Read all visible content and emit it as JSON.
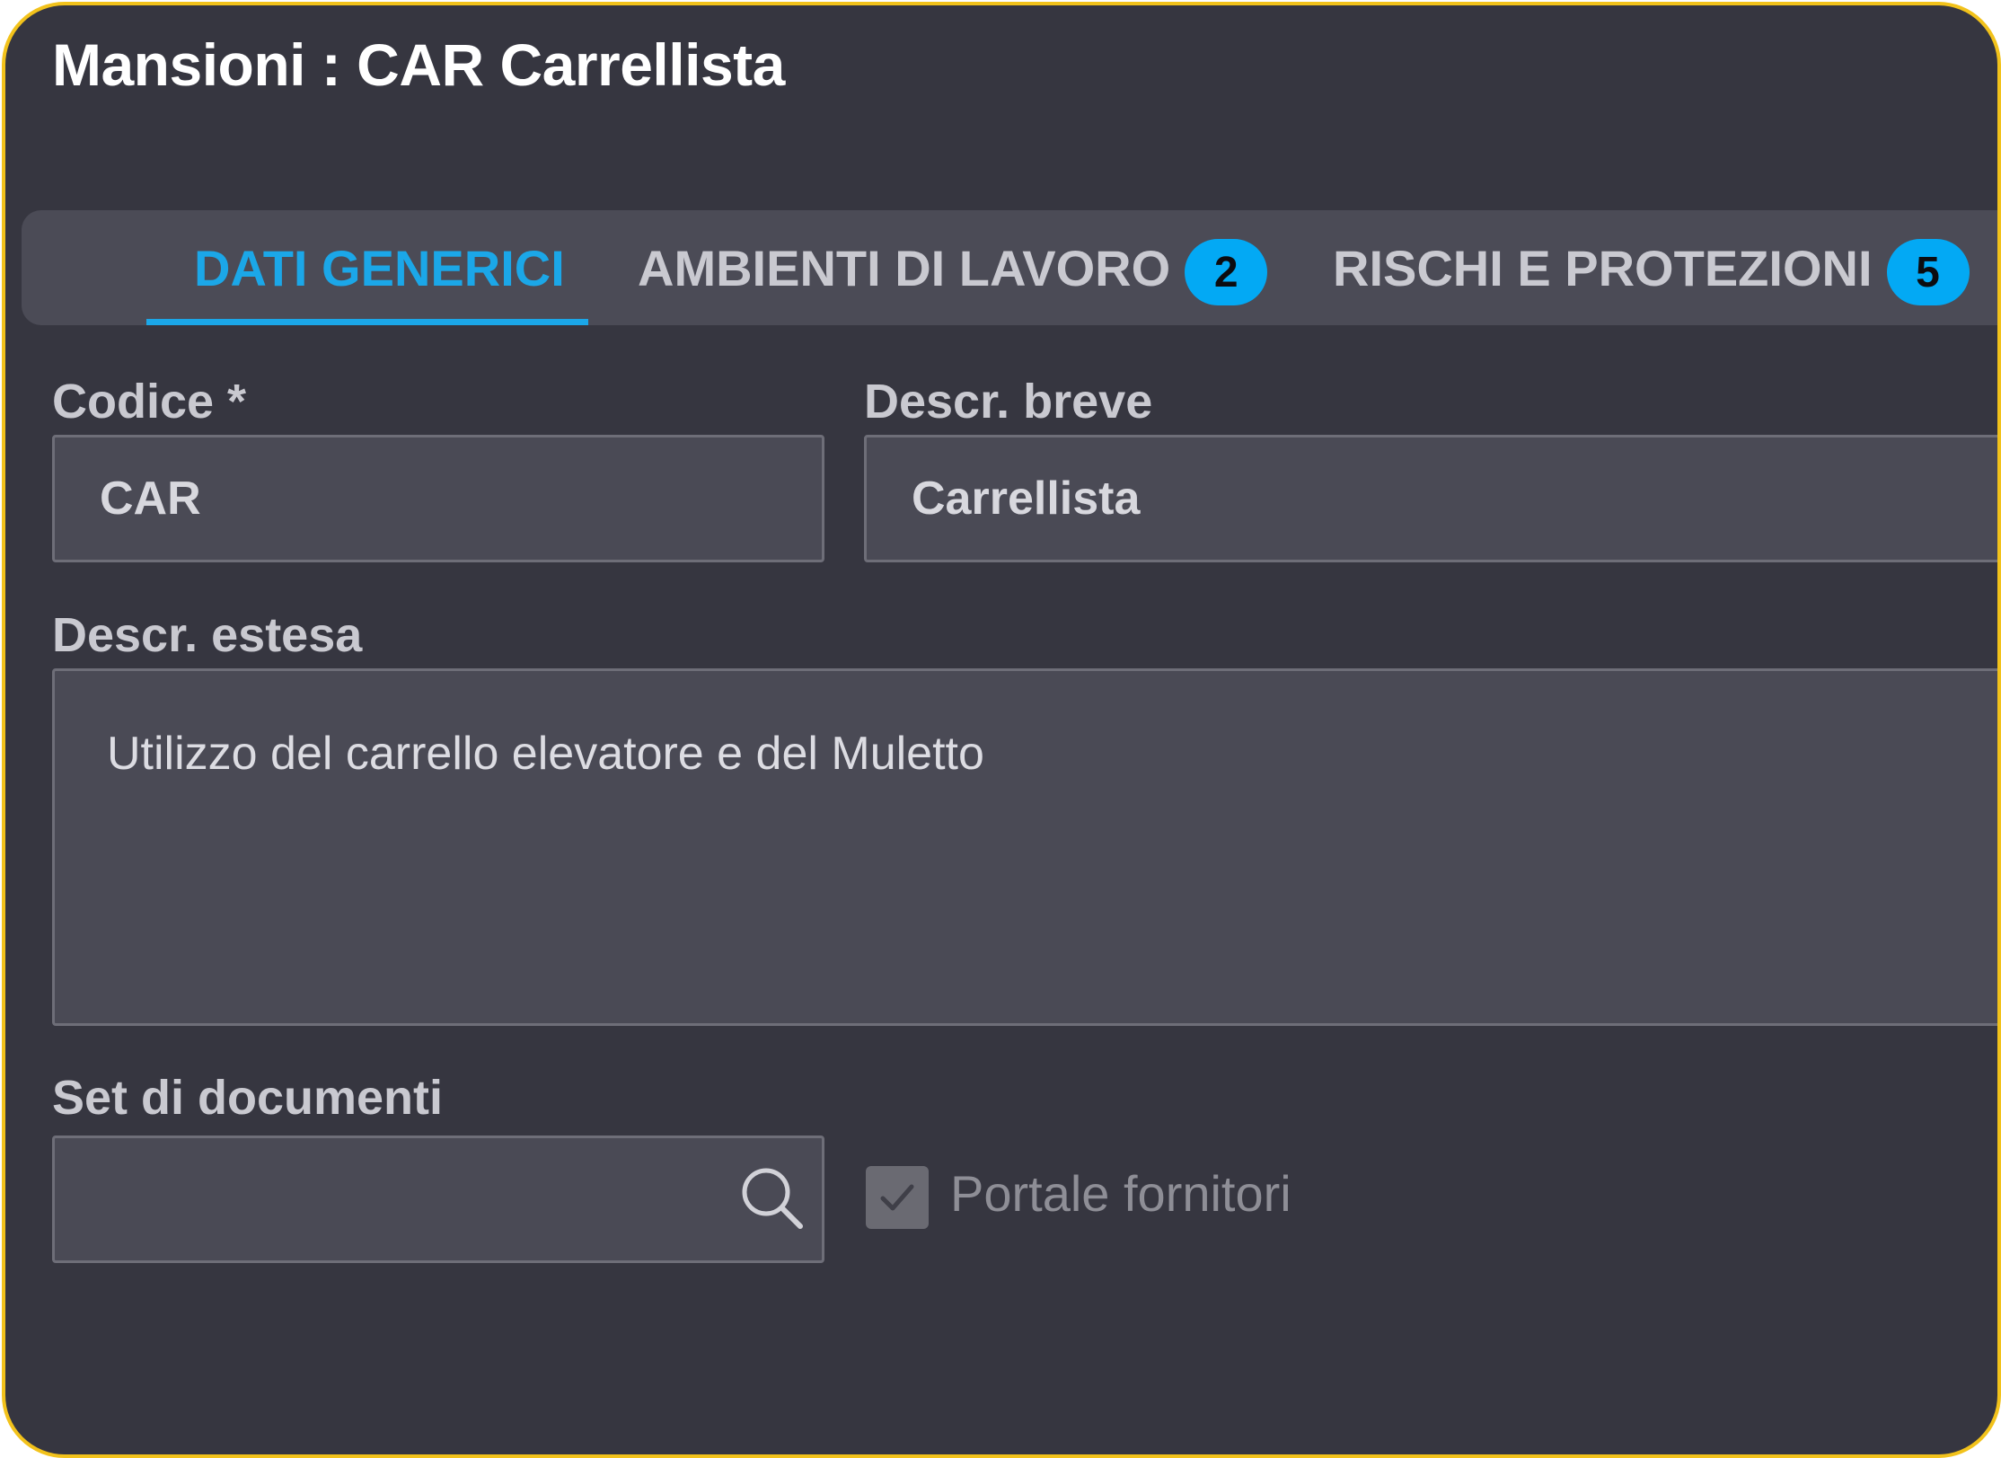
{
  "window": {
    "title": "Mansioni : CAR Carrellista"
  },
  "tabs": [
    {
      "label": "DATI GENERICI",
      "active": true
    },
    {
      "label": "AMBIENTI DI LAVORO",
      "badge": "2"
    },
    {
      "label": "RISCHI E PROTEZIONI",
      "badge": "5"
    }
  ],
  "form": {
    "codice_label": "Codice *",
    "codice_value": "CAR",
    "descr_breve_label": "Descr. breve",
    "descr_breve_value": "Carrellista",
    "descr_estesa_label": "Descr. estesa",
    "descr_estesa_value": "Utilizzo del carrello elevatore e del Muletto",
    "set_documenti_label": "Set di documenti",
    "set_documenti_value": "",
    "portale_fornitori_label": "Portale fornitori",
    "portale_fornitori_checked": true
  },
  "colors": {
    "background": "#363640",
    "accent": "#1ba7e8",
    "badge": "#03a9f4",
    "frame_border": "#f2c21b"
  },
  "icons": [
    "search-icon",
    "check-icon"
  ]
}
